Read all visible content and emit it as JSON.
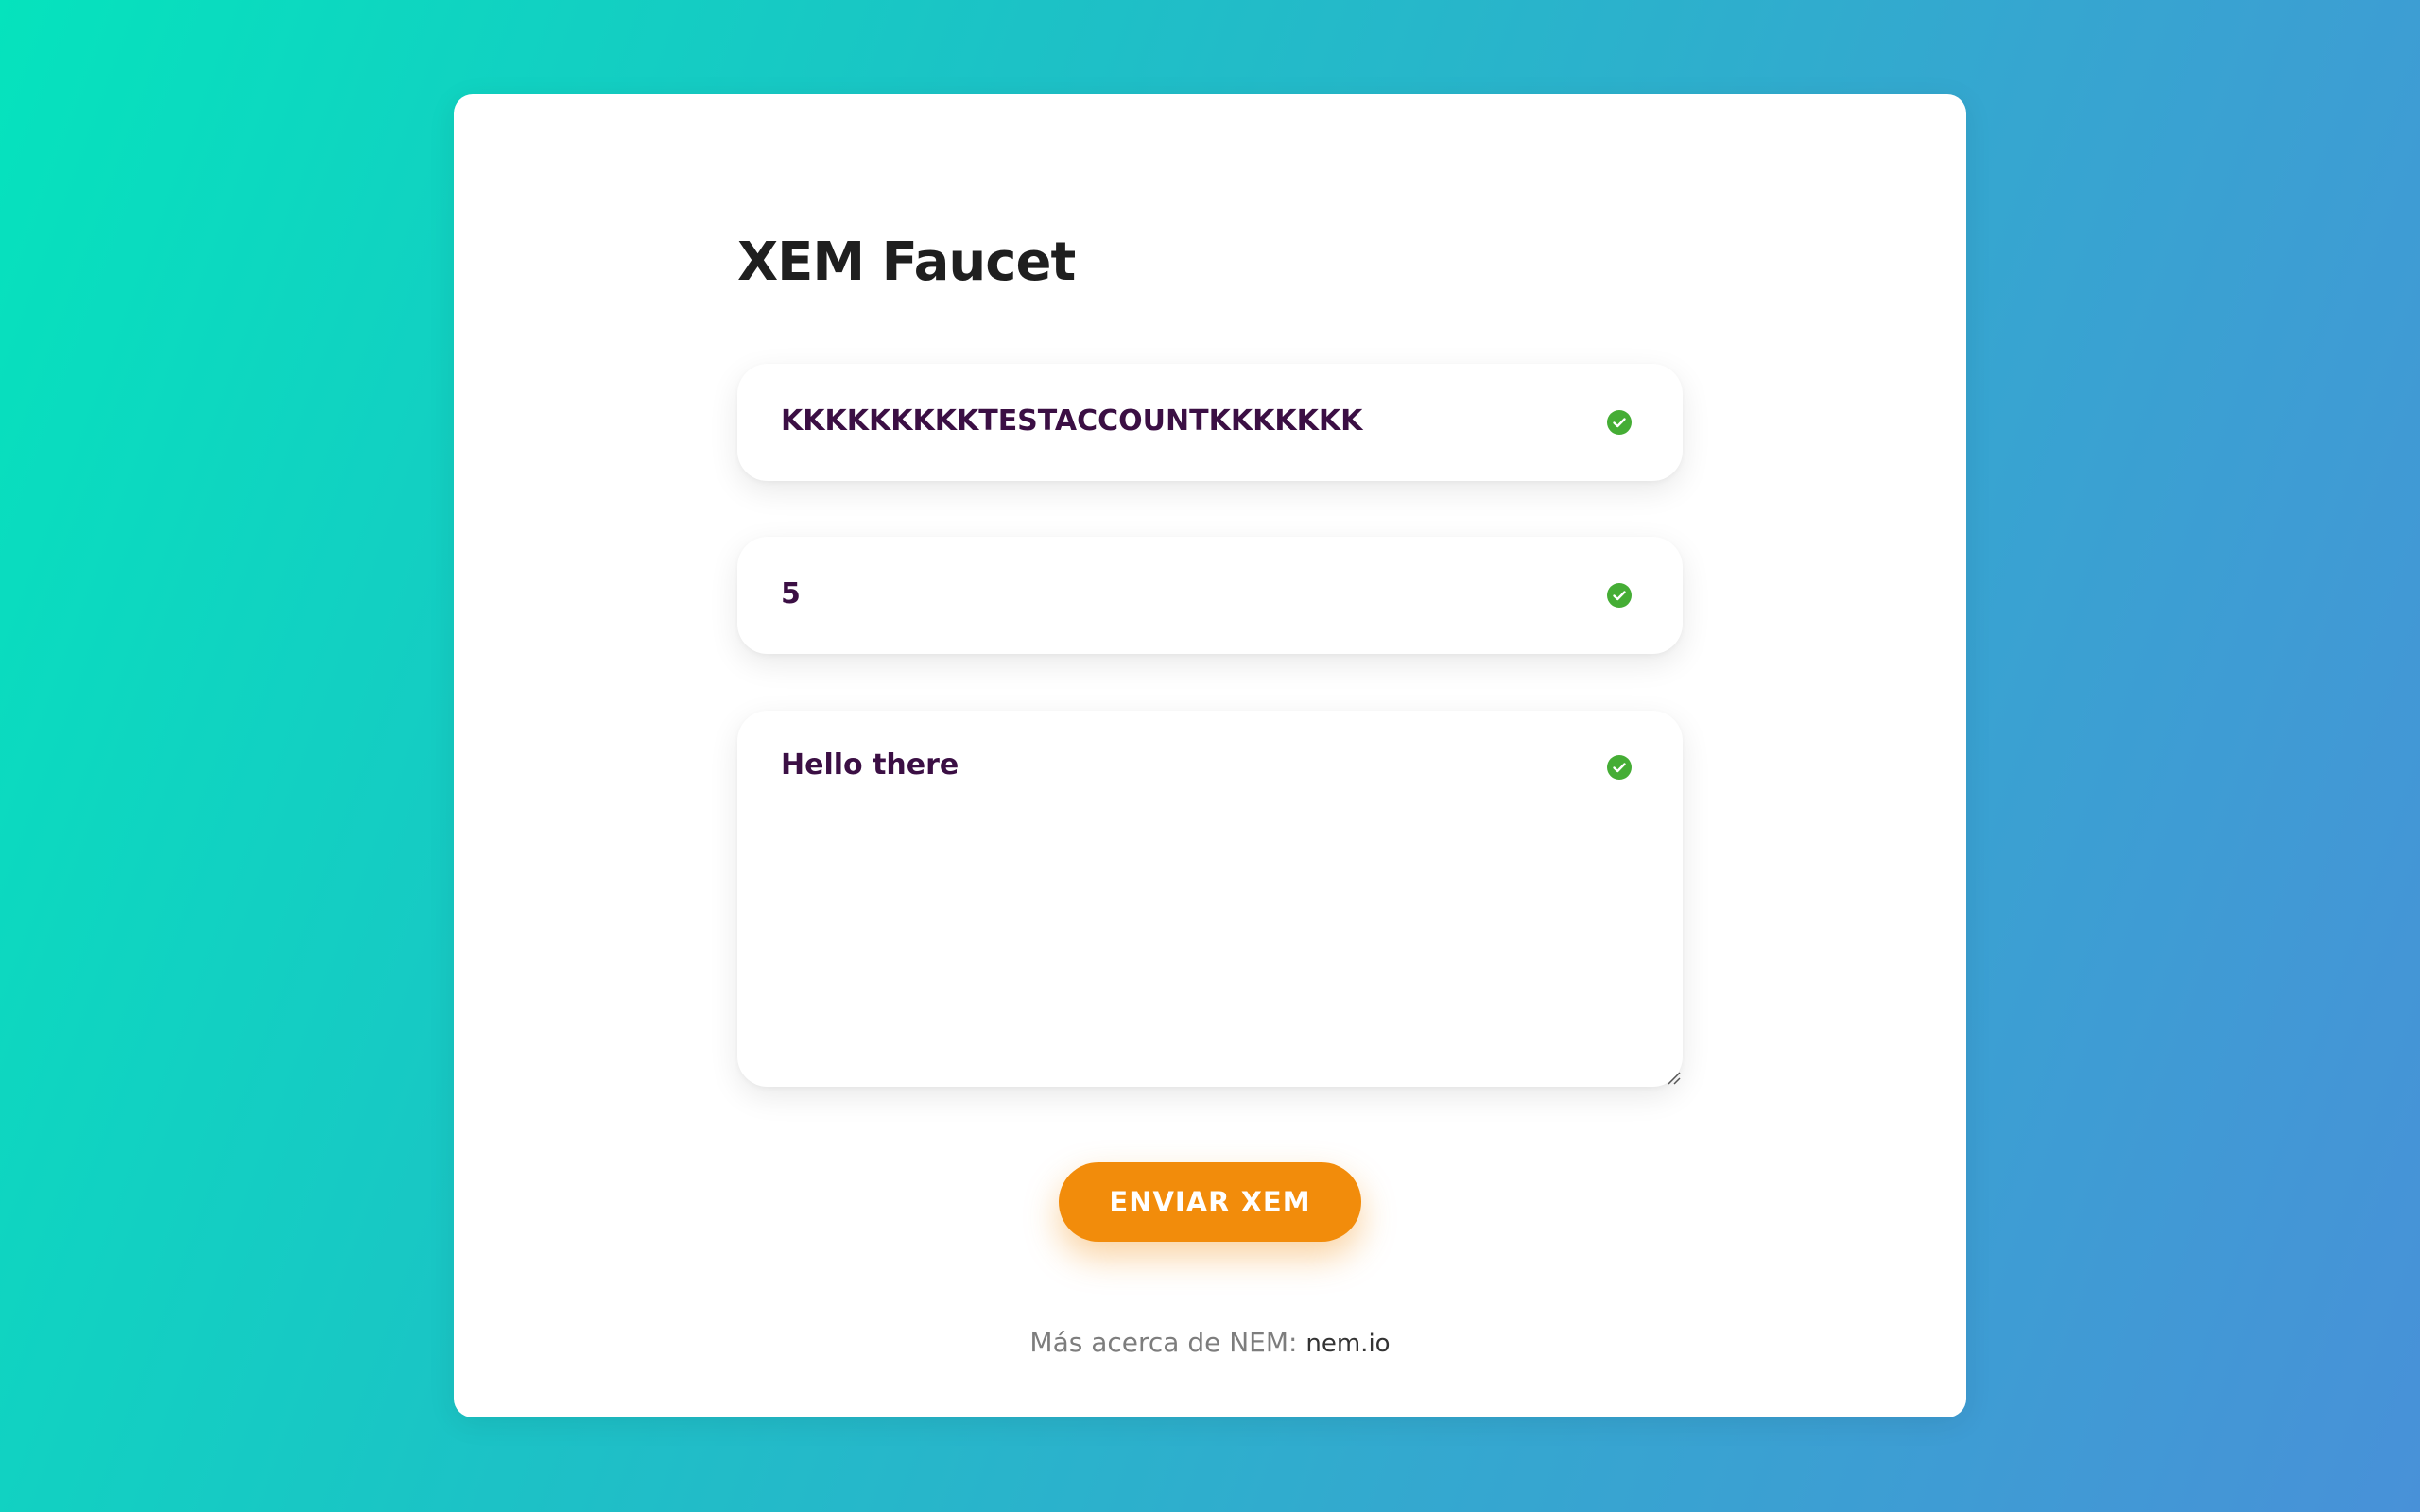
{
  "page": {
    "title": "XEM Faucet"
  },
  "form": {
    "address": {
      "value": "KKKKKKKKKTESTACCOUNTKKKKKKK",
      "status_icon": "check-circle-icon",
      "status_color": "#45ad35"
    },
    "amount": {
      "value": "5",
      "status_icon": "check-circle-icon",
      "status_color": "#45ad35"
    },
    "message": {
      "value": "Hello there",
      "status_icon": "check-circle-icon",
      "status_color": "#45ad35"
    },
    "submit_label": "ENVIAR XEM"
  },
  "footer": {
    "text": "Más acerca de NEM:",
    "link_text": "nem.io"
  },
  "colors": {
    "accent": "#f28c0b",
    "text_dark": "#3b0f44",
    "valid": "#45ad35",
    "gradient_start": "#05e3bd",
    "gradient_end": "#4891d8"
  }
}
